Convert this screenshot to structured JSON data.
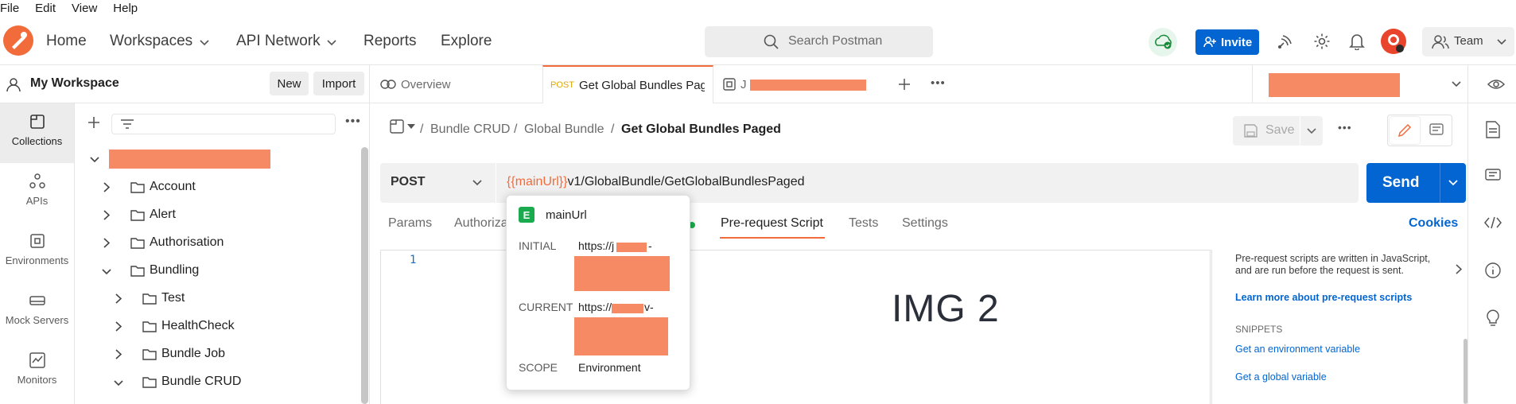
{
  "menu": [
    "File",
    "Edit",
    "View",
    "Help"
  ],
  "header": {
    "home": "Home",
    "workspaces": "Workspaces",
    "api_network": "API Network",
    "reports": "Reports",
    "explore": "Explore",
    "search_placeholder": "Search Postman",
    "invite": "Invite",
    "team": "Team",
    "accent": "#f26b3a"
  },
  "workspace": {
    "title": "My Workspace",
    "new_label": "New",
    "import_label": "Import"
  },
  "rail": [
    {
      "label": "Collections",
      "icon": "collections-icon"
    },
    {
      "label": "APIs",
      "icon": "apis-icon"
    },
    {
      "label": "Environments",
      "icon": "environments-icon"
    },
    {
      "label": "Mock Servers",
      "icon": "mock-servers-icon"
    },
    {
      "label": "Monitors",
      "icon": "monitors-icon"
    }
  ],
  "tree": [
    {
      "label": "Account"
    },
    {
      "label": "Alert"
    },
    {
      "label": "Authorisation"
    },
    {
      "label": "Bundling"
    },
    {
      "label": "Test"
    },
    {
      "label": "HealthCheck"
    },
    {
      "label": "Bundle Job"
    },
    {
      "label": "Bundle CRUD"
    }
  ],
  "tabs": {
    "overview": "Overview",
    "active_method": "POST",
    "active_title": "Get Global Bundles Paged",
    "third_prefix": "J"
  },
  "breadcrumb": {
    "items": [
      "Bundle CRUD",
      "Global Bundle"
    ],
    "current": "Get Global Bundles Paged",
    "separator": "/",
    "save": "Save"
  },
  "request": {
    "method": "POST",
    "url_var": "{{mainUrl}}",
    "url_rest": "v1/GlobalBundle/GetGlobalBundlesPaged",
    "send": "Send"
  },
  "req_tabs": {
    "params": "Params",
    "authorization": "Authoriza",
    "prerequest": "Pre-request Script",
    "tests": "Tests",
    "settings": "Settings",
    "cookies": "Cookies"
  },
  "editor": {
    "line_number": "1",
    "overlay_text": "IMG 2"
  },
  "help": {
    "description": "Pre-request scripts are written in JavaScript, and are run before the request is sent.",
    "learn_more": "Learn more about pre-request scripts",
    "snippets_title": "SNIPPETS",
    "snippets": [
      "Get an environment variable",
      "Get a global variable"
    ]
  },
  "popover": {
    "badge": "E",
    "name": "mainUrl",
    "initial_label": "INITIAL",
    "initial_value": "https://j",
    "initial_suffix": "-",
    "current_label": "CURRENT",
    "current_value": "https://",
    "current_suffix": "v-",
    "scope_label": "SCOPE",
    "scope_value": "Environment"
  }
}
